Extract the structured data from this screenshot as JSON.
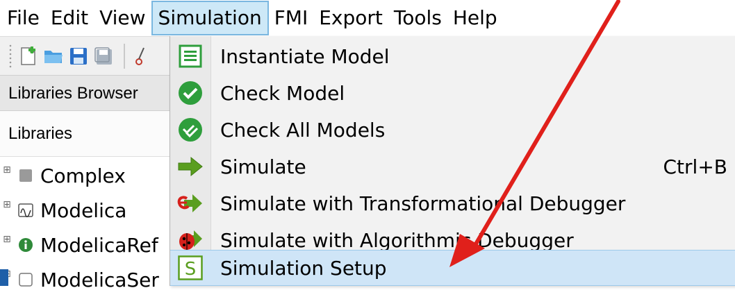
{
  "menubar": {
    "items": [
      "File",
      "Edit",
      "View",
      "Simulation",
      "FMI",
      "Export",
      "Tools",
      "Help"
    ],
    "active": "Simulation"
  },
  "toolbar": {
    "icons": [
      "new-file-icon",
      "open-folder-icon",
      "save-icon",
      "save-all-icon",
      "cut-icon"
    ]
  },
  "libraries_panel": {
    "title": "Libraries Browser",
    "header": "Libraries",
    "tree": [
      {
        "label": "Complex",
        "icon": "complex-icon"
      },
      {
        "label": "Modelica",
        "icon": "modelica-icon"
      },
      {
        "label": "ModelicaRef",
        "icon": "info-icon"
      },
      {
        "label": "ModelicaSer",
        "icon": "package-icon"
      }
    ]
  },
  "simulation_menu": {
    "items": [
      {
        "label": "Instantiate Model",
        "icon": "instantiate-model-icon",
        "shortcut": ""
      },
      {
        "label": "Check Model",
        "icon": "check-model-icon",
        "shortcut": ""
      },
      {
        "label": "Check All Models",
        "icon": "check-all-models-icon",
        "shortcut": ""
      },
      {
        "label": "Simulate",
        "icon": "simulate-arrow-icon",
        "shortcut": "Ctrl+B"
      },
      {
        "label": "Simulate with Transformational Debugger",
        "icon": "transformational-debugger-icon",
        "shortcut": ""
      },
      {
        "label": "Simulate with Algorithmic Debugger",
        "icon": "algorithmic-debugger-icon",
        "shortcut": ""
      },
      {
        "label": "Simulation Setup",
        "icon": "simulation-setup-icon",
        "shortcut": ""
      }
    ],
    "highlighted": "Simulation Setup"
  },
  "colors": {
    "menu_active_bg": "#cde8f7",
    "highlight_bg": "#cfe5f7",
    "arrow": "#e0201b",
    "check_green": "#2e9e3c"
  }
}
